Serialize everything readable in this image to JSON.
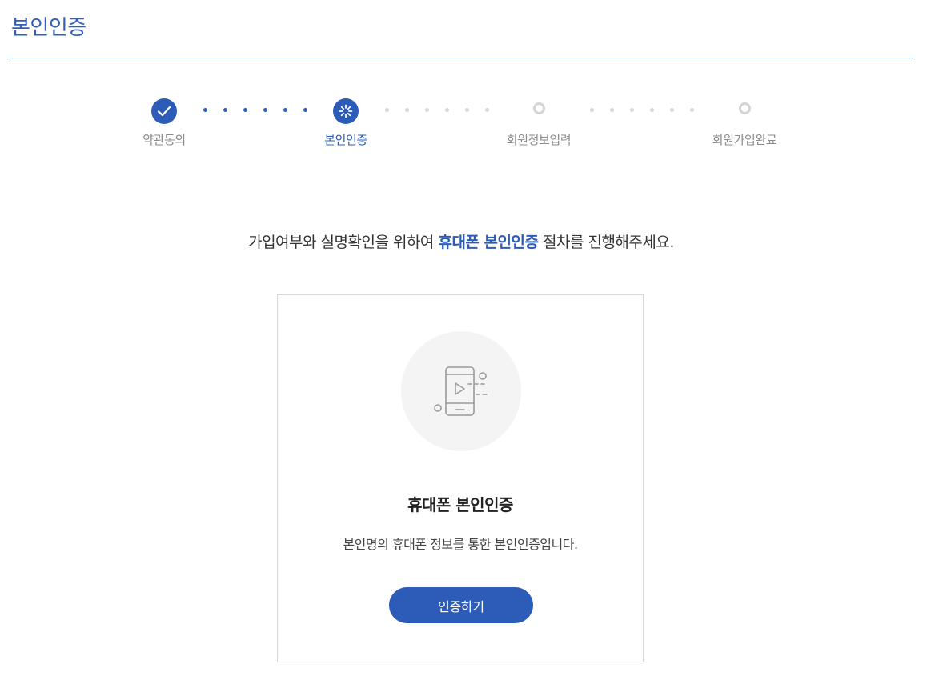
{
  "page": {
    "title": "본인인증"
  },
  "stepper": {
    "steps": [
      {
        "label": "약관동의",
        "state": "done"
      },
      {
        "label": "본인인증",
        "state": "current"
      },
      {
        "label": "회원정보입력",
        "state": "pending"
      },
      {
        "label": "회원가입완료",
        "state": "pending"
      }
    ]
  },
  "guide": {
    "before": "가입여부와 실명확인을 위하여 ",
    "highlight": "휴대폰 본인인증",
    "after": " 절차를 진행해주세요."
  },
  "card": {
    "icon": "mobile-verification-icon",
    "title": "휴대폰 본인인증",
    "description": "본인명의 휴대폰 정보를 통한 본인인증입니다.",
    "button_label": "인증하기"
  },
  "colors": {
    "accent": "#2d5cb8",
    "title": "#2f5fb8",
    "inactive": "#8a8a8a",
    "pending": "#d4d4d4"
  }
}
